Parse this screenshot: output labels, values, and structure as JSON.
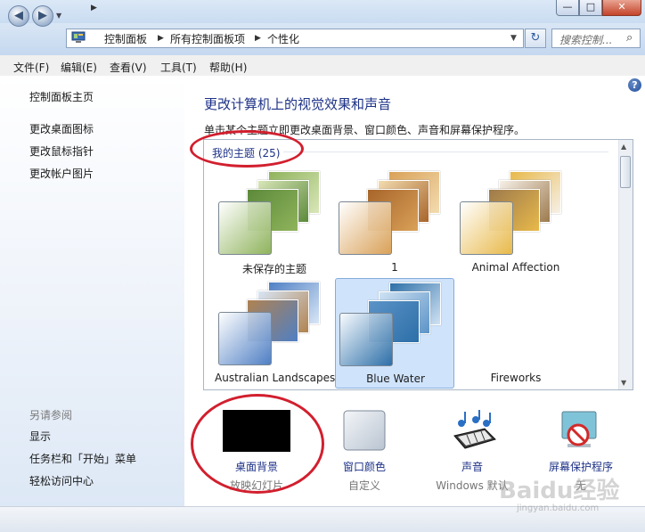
{
  "window": {
    "min_label": "—",
    "max_label": "□",
    "close_label": "✕"
  },
  "nav": {
    "back_label": "◀",
    "fwd_label": "▶",
    "history_label": "▼",
    "crumbs": [
      "控制面板",
      "所有控制面板项",
      "个性化"
    ],
    "crumb_sep": "▶",
    "addr_drop": "▼",
    "refresh_label": "↻",
    "search_placeholder": "搜索控制...",
    "search_icon": "⌕"
  },
  "menu": [
    "文件(F)",
    "编辑(E)",
    "查看(V)",
    "工具(T)",
    "帮助(H)"
  ],
  "sidebar": {
    "home": "控制面板主页",
    "tasks": [
      "更改桌面图标",
      "更改鼠标指针",
      "更改帐户图片"
    ],
    "see_also_title": "另请参阅",
    "see_also": [
      "显示",
      "任务栏和「开始」菜单",
      "轻松访问中心"
    ]
  },
  "main": {
    "help_label": "?",
    "title": "更改计算机上的视觉效果和声音",
    "description": "单击某个主题立即更改桌面背景、窗口颜色、声音和屏幕保护程序。",
    "group_label": "我的主题 (25)",
    "themes": [
      {
        "name": "未保存的主题",
        "selected": false,
        "palette": [
          "#8fb35c",
          "#d9e6b8",
          "#5c8a3a"
        ]
      },
      {
        "name": "1",
        "selected": false,
        "palette": [
          "#d9a158",
          "#f3dcb0",
          "#a8652a"
        ]
      },
      {
        "name": "Animal Affection",
        "selected": false,
        "palette": [
          "#e8b94a",
          "#f6f0e8",
          "#9d7a4d"
        ]
      },
      {
        "name": "Australian Landscapes",
        "selected": false,
        "palette": [
          "#4f7fc4",
          "#d8e6f6",
          "#b08250"
        ]
      },
      {
        "name": "Blue Water",
        "selected": true,
        "palette": [
          "#2d6fa8",
          "#cfe2f3",
          "#5b93c7"
        ]
      },
      {
        "name": "Fireworks",
        "selected": false,
        "palette": [
          "#ffffff",
          "#ffffff",
          "#ffffff"
        ]
      }
    ]
  },
  "settings": [
    {
      "label": "桌面背景",
      "value": "放映幻灯片",
      "icon": "desktop-background-icon"
    },
    {
      "label": "窗口颜色",
      "value": "自定义",
      "icon": "window-color-icon"
    },
    {
      "label": "声音",
      "value": "Windows 默认",
      "icon": "sounds-icon"
    },
    {
      "label": "屏幕保护程序",
      "value": "无",
      "icon": "screen-saver-icon"
    }
  ],
  "watermark": {
    "main": "Baidu经验",
    "sub": "jingyan.baidu.com"
  },
  "colors": {
    "link": "#1e3287",
    "annotation": "#d21f2e",
    "selected": "#cfe3fb"
  }
}
